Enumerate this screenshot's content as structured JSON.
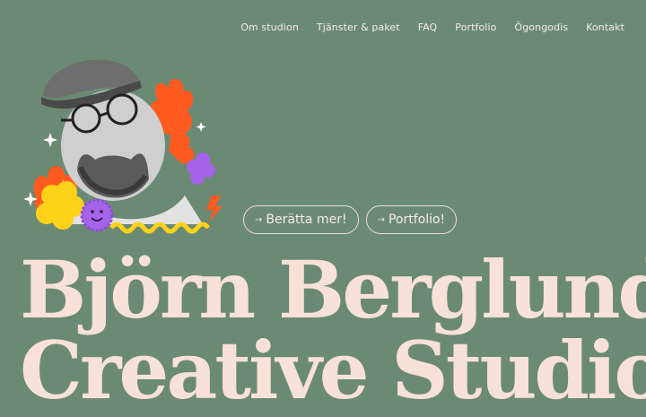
{
  "nav": {
    "items": [
      {
        "label": "Om studion"
      },
      {
        "label": "Tjänster & paket"
      },
      {
        "label": "FAQ"
      },
      {
        "label": "Portfolio"
      },
      {
        "label": "Ögongodis"
      },
      {
        "label": "Kontakt"
      }
    ]
  },
  "cta": {
    "more_label": "Berätta mer!",
    "portfolio_label": "Portfolio!",
    "arrow_glyph": "→"
  },
  "headline": {
    "line1": "Björn Berglund",
    "line2": "Creative Studio"
  },
  "colors": {
    "background": "#6b8a74",
    "headline": "#f7e1d8",
    "accent_orange": "#ff5a1f",
    "accent_yellow": "#ffd21a",
    "accent_purple": "#a463e8"
  },
  "hero_image": {
    "icon": "portrait-illustration"
  }
}
